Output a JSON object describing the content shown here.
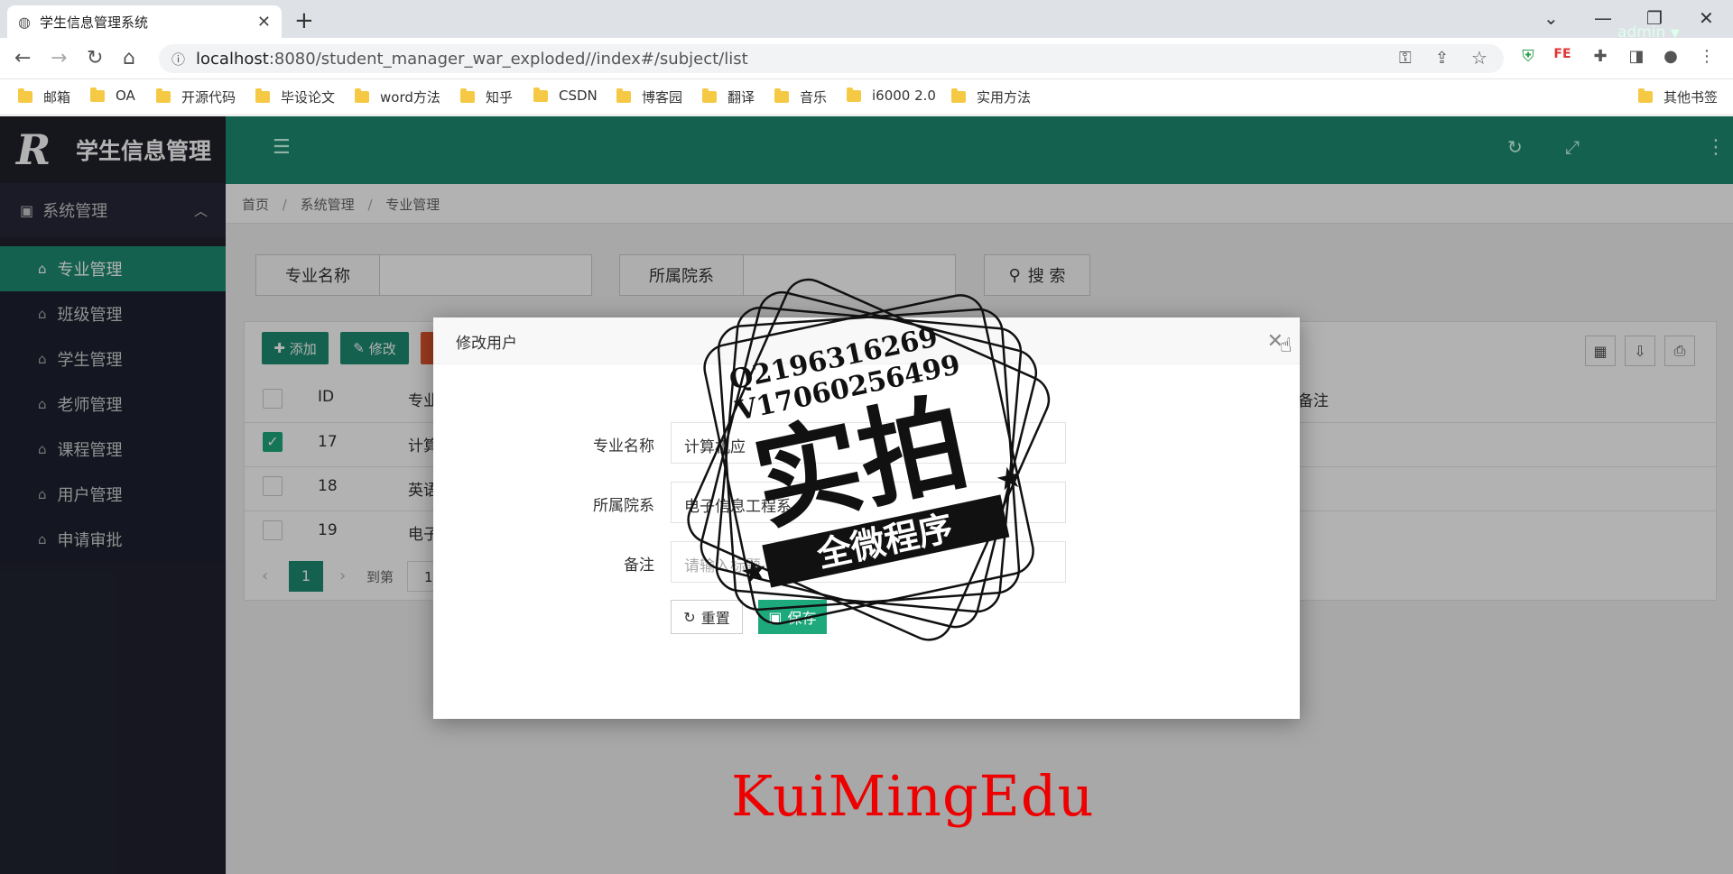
{
  "browser": {
    "tab_title": "学生信息管理系统",
    "url_host": "localhost",
    "url_path": ":8080/student_manager_war_exploded//index#/subject/list",
    "bookmarks": [
      "邮箱",
      "OA",
      "开源代码",
      "毕设论文",
      "word方法",
      "知乎",
      "CSDN",
      "博客园",
      "翻译",
      "音乐",
      "i6000 2.0",
      "实用方法"
    ],
    "other_bookmarks": "其他书签"
  },
  "app": {
    "logo_mark": "R",
    "title": "学生信息管理",
    "user": "admin",
    "sidebar": {
      "group": "系统管理",
      "items": [
        {
          "label": "专业管理",
          "active": true
        },
        {
          "label": "班级管理"
        },
        {
          "label": "学生管理"
        },
        {
          "label": "老师管理"
        },
        {
          "label": "课程管理"
        },
        {
          "label": "用户管理"
        },
        {
          "label": "申请审批"
        }
      ]
    },
    "breadcrumb": [
      "首页",
      "系统管理",
      "专业管理"
    ],
    "search": {
      "name_label": "专业名称",
      "dept_label": "所属院系",
      "search_button": "搜 索"
    },
    "toolbar": {
      "add": "添加",
      "edit": "修改"
    },
    "table": {
      "headers": {
        "id": "ID",
        "name": "专业",
        "remark": "备注"
      },
      "rows": [
        {
          "id": "17",
          "name": "计算",
          "checked": true
        },
        {
          "id": "18",
          "name": "英语",
          "checked": false
        },
        {
          "id": "19",
          "name": "电子",
          "checked": false
        }
      ]
    },
    "pagination": {
      "current": "1",
      "goto_label": "到第",
      "goto_value": "1"
    }
  },
  "modal": {
    "title": "修改用户",
    "fields": [
      {
        "label": "专业名称",
        "value": "计算机应"
      },
      {
        "label": "所属院系",
        "value": "电子信息工程系"
      },
      {
        "label": "备注",
        "placeholder": "请输入标题"
      }
    ],
    "reset_button": "重置",
    "save_button": "保存"
  },
  "overlay": {
    "stamp_lines": [
      "Q2196316269",
      "V17060256499",
      "实拍",
      "全微程序"
    ],
    "watermark": "KuiMingEdu",
    "watermark_color": "#ee0000"
  },
  "colors": {
    "accent": "#1e8c72",
    "sidebar": "#202230",
    "button_red": "#e0532f"
  }
}
